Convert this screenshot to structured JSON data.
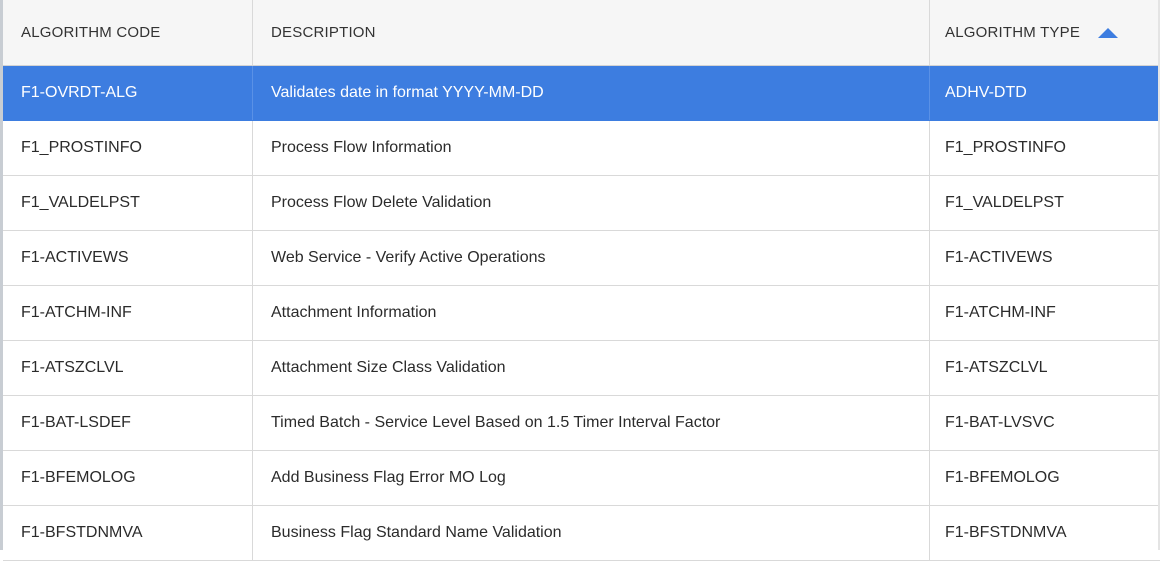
{
  "table": {
    "headers": {
      "code": "ALGORITHM CODE",
      "description": "DESCRIPTION",
      "type": "ALGORITHM TYPE"
    },
    "sort_icon": "sort-ascending-icon",
    "rows": [
      {
        "code": "F1-OVRDT-ALG",
        "description": "Validates date in format YYYY-MM-DD",
        "type": "ADHV-DTD",
        "selected": true
      },
      {
        "code": "F1_PROSTINFO",
        "description": "Process Flow Information",
        "type": "F1_PROSTINFO"
      },
      {
        "code": "F1_VALDELPST",
        "description": "Process Flow Delete Validation",
        "type": "F1_VALDELPST"
      },
      {
        "code": "F1-ACTIVEWS",
        "description": "Web Service - Verify Active Operations",
        "type": "F1-ACTIVEWS"
      },
      {
        "code": "F1-ATCHM-INF",
        "description": "Attachment Information",
        "type": "F1-ATCHM-INF"
      },
      {
        "code": "F1-ATSZCLVL",
        "description": "Attachment Size Class Validation",
        "type": "F1-ATSZCLVL"
      },
      {
        "code": "F1-BAT-LSDEF",
        "description": "Timed Batch - Service Level Based on 1.5 Timer Interval Factor",
        "type": "F1-BAT-LVSVC"
      },
      {
        "code": "F1-BFEMOLOG",
        "description": "Add Business Flag Error MO Log",
        "type": "F1-BFEMOLOG"
      },
      {
        "code": "F1-BFSTDNMVA",
        "description": "Business Flag Standard Name Validation",
        "type": "F1-BFSTDNMVA"
      }
    ]
  },
  "colors": {
    "selected_row": "#3d7de0",
    "header_bg": "#f6f6f6",
    "sort_icon": "#3d7de0"
  }
}
